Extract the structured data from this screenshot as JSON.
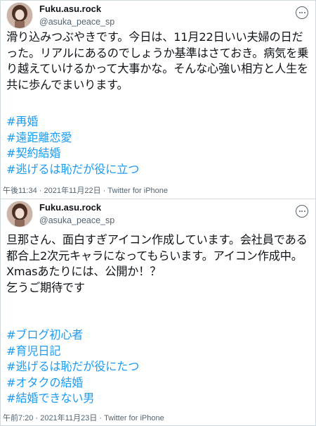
{
  "tweets": [
    {
      "display_name": "Fuku.asu.rock",
      "handle": "@asuka_peace_sp",
      "text": "滑り込みつぶやきです。今日は、11月22日いい夫婦の日だった。リアルにあるのでしょうか基準はさておき。病気を乗り越えていけるかって大事かな。そんな心強い相方と人生を共に歩んでまいります。",
      "hashtags": [
        "#再婚",
        "#遠距離恋愛",
        "#契約結婚",
        "#逃げるは恥だが役に立つ"
      ],
      "time": "午後11:34",
      "date": "2021年11月22日",
      "source": "Twitter for iPhone"
    },
    {
      "display_name": "Fuku.asu.rock",
      "handle": "@asuka_peace_sp",
      "text": "旦那さん、面白すぎアイコン作成しています。会社員である都合上2次元キャラになってもらいます。アイコン作成中。\nXmasあたりには、公開か！？\n乞うご期待です",
      "hashtags": [
        "#ブログ初心者",
        "#育児日記",
        "#逃げるは恥だが役にたつ",
        "#オタクの結婚",
        "#結婚できない男"
      ],
      "time": "午前7:20",
      "date": "2021年11月23日",
      "source": "Twitter for iPhone"
    }
  ],
  "icons": {
    "avatar": "avatar-photo",
    "more": "more-options-icon"
  },
  "colors": {
    "text": "#0f1419",
    "secondary": "#536471",
    "hashtag": "#1d9bf0",
    "border": "#cfd9de"
  },
  "meta_separator": " · "
}
